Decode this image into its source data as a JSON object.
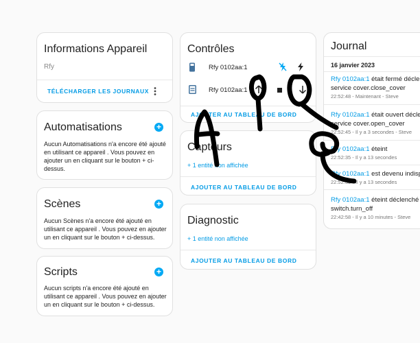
{
  "device_info": {
    "title": "Informations Appareil",
    "subtitle": "Rfy",
    "download_logs": "TÉLÉCHARGER LES JOURNAUX",
    "menu_icon": "dots-vertical-icon"
  },
  "automations": {
    "title": "Automatisations",
    "text": "Aucun Automatisations n'a encore été ajouté en utilisant ce appareil . Vous pouvez en ajouter un en cliquant sur le bouton + ci-dessus."
  },
  "scenes": {
    "title": "Scènes",
    "text": "Aucun Scènes n'a encore été ajouté en utilisant ce appareil . Vous pouvez en ajouter un en cliquant sur le bouton + ci-dessus."
  },
  "scripts": {
    "title": "Scripts",
    "text": "Aucun scripts n'a encore été ajouté en utilisant ce appareil . Vous pouvez en ajouter un en cliquant sur le bouton + ci-dessus."
  },
  "controls": {
    "title": "Contrôles",
    "entities": [
      {
        "name": "Rfy 0102aa:1",
        "icon": "remote-icon",
        "actions": [
          "flash-off-icon",
          "flash-icon"
        ]
      },
      {
        "name": "Rfy 0102aa:1",
        "icon": "window-shutter-icon",
        "actions": [
          "arrow-up-icon",
          "stop-icon",
          "arrow-down-icon"
        ]
      }
    ],
    "add_button": "AJOUTER AU TABLEAU DE BORD"
  },
  "sensors": {
    "title": "Capteurs",
    "hidden_entities": "+ 1 entité non affichée",
    "add_button": "AJOUTER AU TABLEAU DE BORD"
  },
  "diagnostic": {
    "title": "Diagnostic",
    "hidden_entities": "+ 1 entité non affichée",
    "add_button": "AJOUTER AU TABLEAU DE BORD"
  },
  "logbook": {
    "title": "Journal",
    "date": "16 janvier 2023",
    "entries": [
      {
        "entity": "Rfy 0102aa:1",
        "message": " était fermé déclenché par le service cover.close_cover",
        "line2": "service cover.close_cover",
        "meta": "22:52:48 - Maintenant - Steve"
      },
      {
        "entity": "Rfy 0102aa:1",
        "message": " était ouvert déclenché par le",
        "line2": "service cover.open_cover",
        "meta": "22:52:45 - Il y a 3 secondes - Steve"
      },
      {
        "entity": "Rfy 0102aa:1",
        "message": " éteint",
        "line2": "",
        "meta": "22:52:35 - Il y a 13 secondes"
      },
      {
        "entity": "Rfy 0102aa:1",
        "message": " est devenu indisponible",
        "line2": "",
        "meta": "22:52:35 - Il y a 13 secondes"
      },
      {
        "entity": "Rfy 0102aa:1",
        "message": " éteint déclenché par le service",
        "line2": "switch.turn_off",
        "meta": "22:42:58 - Il y a 10 minutes - Steve"
      }
    ]
  },
  "annotation": {
    "letter": "A",
    "color": "#000000"
  }
}
